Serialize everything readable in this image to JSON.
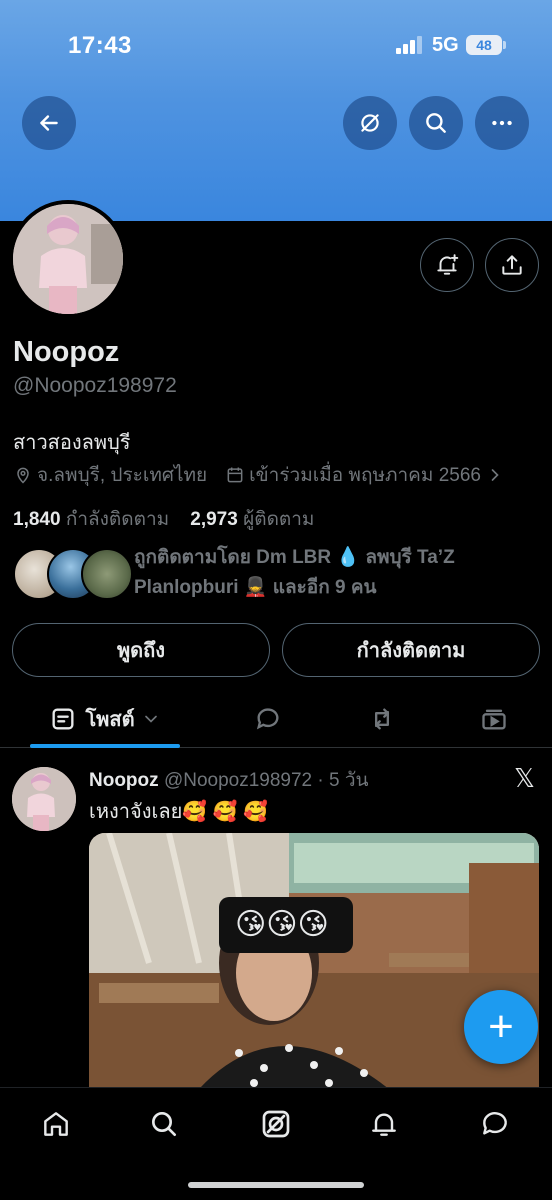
{
  "status_bar": {
    "time": "17:43",
    "network": "5G",
    "battery": "48"
  },
  "profile": {
    "name": "Noopoz",
    "handle": "@Noopoz198972",
    "bio": "สาวสองลพบุรี",
    "location": "จ.ลพบุรี, ประเทศไทย",
    "joined": "เข้าร่วมเมื่อ พฤษภาคม 2566",
    "following_count": "1,840",
    "following_label": "กำลังติดตาม",
    "followers_count": "2,973",
    "followers_label": "ผู้ติดตาม",
    "followed_by_line1": "ถูกติดตามโดย Dm LBR 💧 ลพบุรี Ta’Z",
    "followed_by_line2": "Planlopburi 💂 และอีก 9 คน"
  },
  "actions": {
    "mention": "พูดถึง",
    "following": "กำลังติดตาม"
  },
  "tabs": {
    "posts_label": "โพสต์"
  },
  "post": {
    "name": "Noopoz",
    "handle": "@Noopoz198972",
    "time": "· 5 วัน",
    "text": "เหงาจังเลย🥰 🥰 🥰",
    "sticker": "😘😘😘",
    "x_logo": "𝕏"
  },
  "fab": {
    "label": "+"
  },
  "colors": {
    "accent": "#1d9bf0",
    "banner": "#4f93e0",
    "muted": "#71767b"
  },
  "icons": [
    "back-icon",
    "grok-icon",
    "search-icon",
    "more-icon",
    "notification-add-icon",
    "share-icon",
    "location-icon",
    "calendar-icon",
    "posts-icon",
    "replies-icon",
    "repost-icon",
    "media-icon",
    "home-icon",
    "explore-icon",
    "grok-nav-icon",
    "notifications-icon",
    "messages-icon"
  ]
}
